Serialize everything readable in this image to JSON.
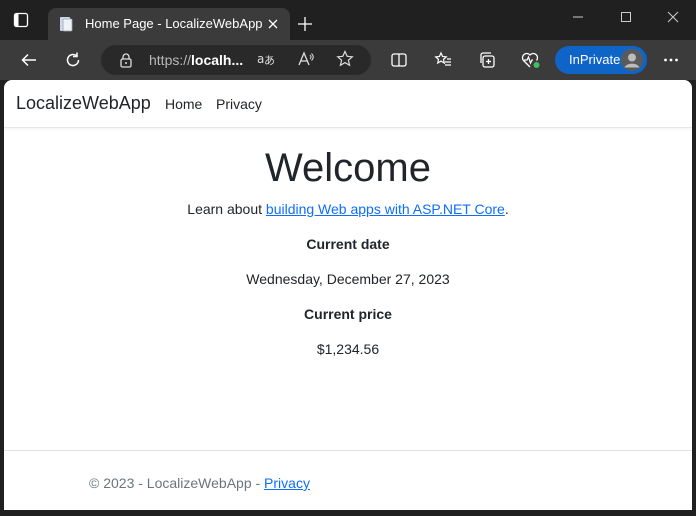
{
  "browser": {
    "tab_title": "Home Page - LocalizeWebApp",
    "url_prefix": "https://",
    "url_host": "localh...",
    "inprivate_label": "InPrivate"
  },
  "page": {
    "brand": "LocalizeWebApp",
    "nav": [
      {
        "label": "Home"
      },
      {
        "label": "Privacy"
      }
    ],
    "heading": "Welcome",
    "learn_prefix": "Learn about ",
    "learn_link": "building Web apps with ASP.NET Core",
    "learn_suffix": ".",
    "current_date_label": "Current date",
    "current_date_value": "Wednesday, December 27, 2023",
    "current_price_label": "Current price",
    "current_price_value": "$1,234.56"
  },
  "footer": {
    "text": "© 2023 - LocalizeWebApp - ",
    "link": "Privacy"
  },
  "colors": {
    "link": "#0d6efd",
    "inprivate": "#0f64c8",
    "chrome_dark": "#202020",
    "chrome_tab": "#3b3b3b"
  }
}
